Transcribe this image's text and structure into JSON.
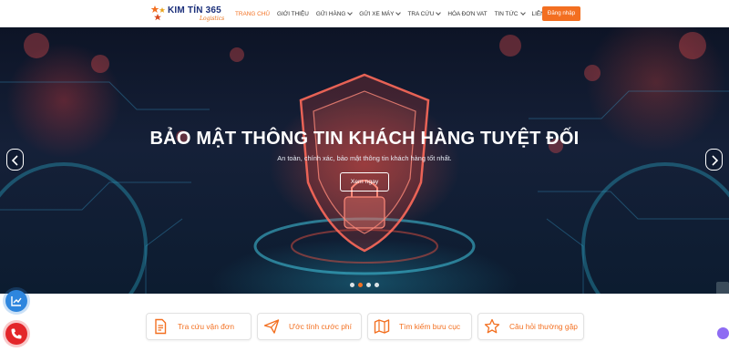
{
  "header": {
    "logo": {
      "brand": "KIM TÍN 365",
      "sub": "Logistics"
    },
    "nav": [
      {
        "label": "TRANG CHỦ",
        "active": true,
        "dropdown": false
      },
      {
        "label": "GIỚI THIỆU",
        "active": false,
        "dropdown": false
      },
      {
        "label": "GỬI HÀNG",
        "active": false,
        "dropdown": true
      },
      {
        "label": "GỬI XE MÁY",
        "active": false,
        "dropdown": true
      },
      {
        "label": "TRA CỨU",
        "active": false,
        "dropdown": true
      },
      {
        "label": "HÓA ĐƠN VAT",
        "active": false,
        "dropdown": false
      },
      {
        "label": "TIN TỨC",
        "active": false,
        "dropdown": true
      },
      {
        "label": "LIÊN HỆ",
        "active": false,
        "dropdown": false
      }
    ],
    "login_label": "Đăng nhập"
  },
  "hero": {
    "title": "BẢO MẬT THÔNG TIN KHÁCH HÀNG TUYỆT ĐỐI",
    "subtitle": "An toàn, chính xác, bảo mật thông tin khách hàng tốt nhất.",
    "cta_label": "Xem ngay",
    "slide_count": 4,
    "active_slide": 2
  },
  "quick_links": [
    {
      "label": "Tra cứu vận đơn",
      "icon": "document-icon"
    },
    {
      "label": "Ước tính cước phí",
      "icon": "paper-plane-icon"
    },
    {
      "label": "Tìm kiếm bưu cục",
      "icon": "map-icon"
    },
    {
      "label": "Câu hỏi thường gặp",
      "icon": "star-icon"
    }
  ],
  "colors": {
    "accent": "#f37021",
    "brand_navy": "#1b2f7a",
    "chart_button": "#2e86de",
    "phone_button": "#e3262a"
  }
}
